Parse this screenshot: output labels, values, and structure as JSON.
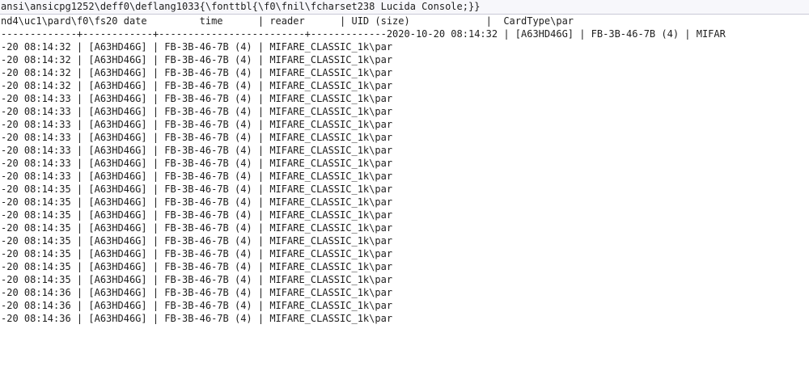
{
  "editor": {
    "header_line": "ansi\\ansicpg1252\\deff0\\deflang1033{\\fonttbl{\\f0\\fnil\\fcharset238 Lucida Console;}}",
    "column_line": "nd4\\uc1\\pard\\f0\\fs20 date         time      | reader      | UID (size)             |  CardType\\par",
    "separator_line": "-------------+------------+-------------------------+-------------2020-10-20 08:14:32 | [A63HD46G] | FB-3B-46-7B (4) | MIFAR",
    "rows": [
      "-20 08:14:32 | [A63HD46G] | FB-3B-46-7B (4) | MIFARE_CLASSIC_1k\\par",
      "-20 08:14:32 | [A63HD46G] | FB-3B-46-7B (4) | MIFARE_CLASSIC_1k\\par",
      "-20 08:14:32 | [A63HD46G] | FB-3B-46-7B (4) | MIFARE_CLASSIC_1k\\par",
      "-20 08:14:32 | [A63HD46G] | FB-3B-46-7B (4) | MIFARE_CLASSIC_1k\\par",
      "-20 08:14:33 | [A63HD46G] | FB-3B-46-7B (4) | MIFARE_CLASSIC_1k\\par",
      "-20 08:14:33 | [A63HD46G] | FB-3B-46-7B (4) | MIFARE_CLASSIC_1k\\par",
      "-20 08:14:33 | [A63HD46G] | FB-3B-46-7B (4) | MIFARE_CLASSIC_1k\\par",
      "-20 08:14:33 | [A63HD46G] | FB-3B-46-7B (4) | MIFARE_CLASSIC_1k\\par",
      "-20 08:14:33 | [A63HD46G] | FB-3B-46-7B (4) | MIFARE_CLASSIC_1k\\par",
      "-20 08:14:33 | [A63HD46G] | FB-3B-46-7B (4) | MIFARE_CLASSIC_1k\\par",
      "-20 08:14:33 | [A63HD46G] | FB-3B-46-7B (4) | MIFARE_CLASSIC_1k\\par",
      "-20 08:14:35 | [A63HD46G] | FB-3B-46-7B (4) | MIFARE_CLASSIC_1k\\par",
      "-20 08:14:35 | [A63HD46G] | FB-3B-46-7B (4) | MIFARE_CLASSIC_1k\\par",
      "-20 08:14:35 | [A63HD46G] | FB-3B-46-7B (4) | MIFARE_CLASSIC_1k\\par",
      "-20 08:14:35 | [A63HD46G] | FB-3B-46-7B (4) | MIFARE_CLASSIC_1k\\par",
      "-20 08:14:35 | [A63HD46G] | FB-3B-46-7B (4) | MIFARE_CLASSIC_1k\\par",
      "-20 08:14:35 | [A63HD46G] | FB-3B-46-7B (4) | MIFARE_CLASSIC_1k\\par",
      "-20 08:14:35 | [A63HD46G] | FB-3B-46-7B (4) | MIFARE_CLASSIC_1k\\par",
      "-20 08:14:35 | [A63HD46G] | FB-3B-46-7B (4) | MIFARE_CLASSIC_1k\\par",
      "-20 08:14:36 | [A63HD46G] | FB-3B-46-7B (4) | MIFARE_CLASSIC_1k\\par",
      "-20 08:14:36 | [A63HD46G] | FB-3B-46-7B (4) | MIFARE_CLASSIC_1k\\par",
      "-20 08:14:36 | [A63HD46G] | FB-3B-46-7B (4) | MIFARE_CLASSIC_1k\\par"
    ]
  }
}
